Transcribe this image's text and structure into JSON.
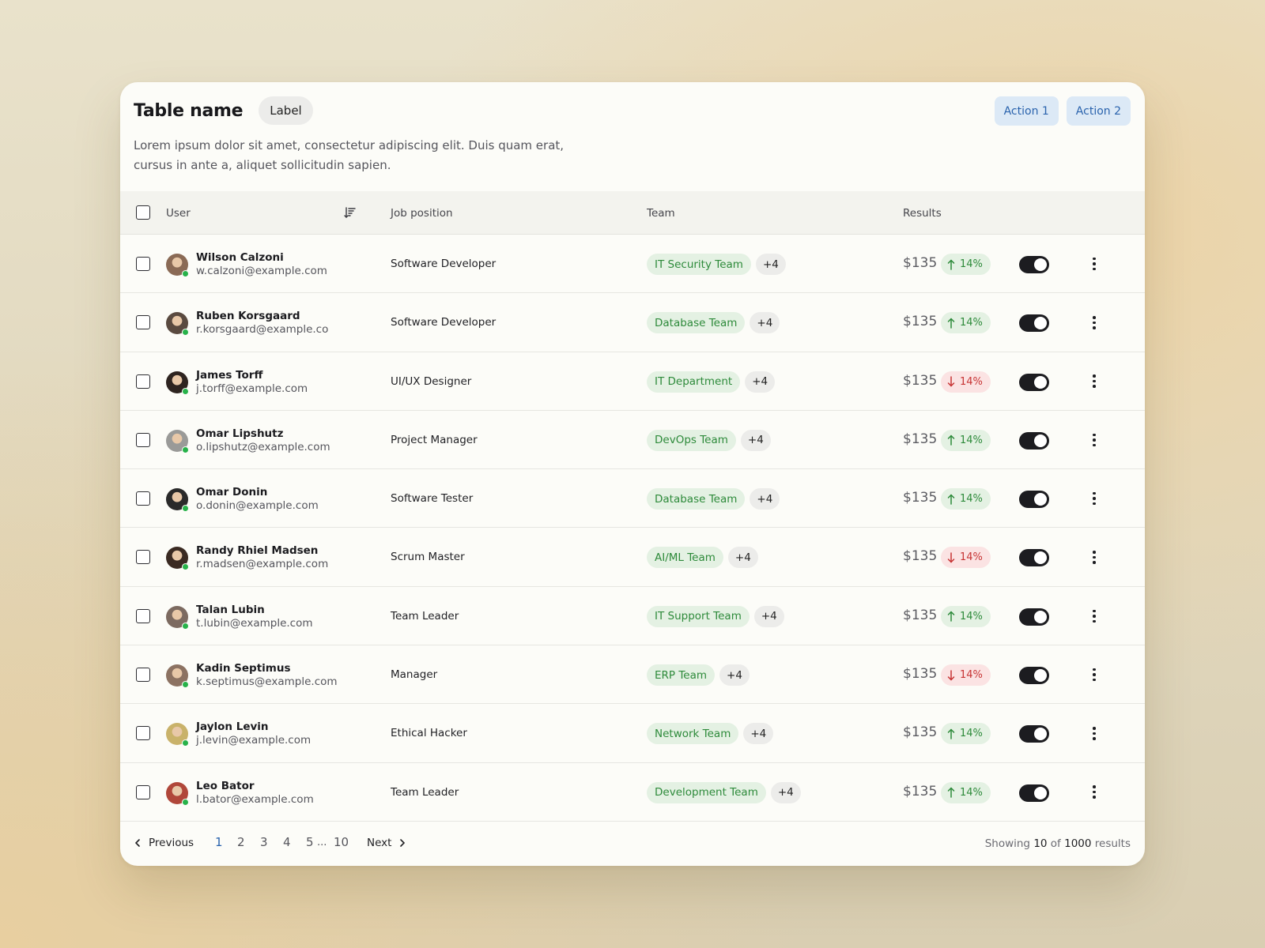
{
  "header": {
    "title": "Table name",
    "label": "Label",
    "description": "Lorem ipsum dolor sit amet, consectetur adipiscing elit. Duis quam erat, cursus in ante a, aliquet sollicitudin sapien.",
    "actions": [
      "Action 1",
      "Action 2"
    ]
  },
  "columns": {
    "user": "User",
    "job": "Job position",
    "team": "Team",
    "results": "Results"
  },
  "rows": [
    {
      "name": "Wilson Calzoni",
      "email": "w.calzoni@example.com",
      "job": "Software Developer",
      "team": "IT Security Team",
      "extra": "+4",
      "amount": "$135",
      "trend": "up",
      "percent": "14%",
      "toggle_on": true,
      "avatar_color": "#8a6a55"
    },
    {
      "name": "Ruben Korsgaard",
      "email": "r.korsgaard@example.co",
      "job": "Software Developer",
      "team": "Database Team",
      "extra": "+4",
      "amount": "$135",
      "trend": "up",
      "percent": "14%",
      "toggle_on": true,
      "avatar_color": "#5a4a40"
    },
    {
      "name": "James Torff",
      "email": "j.torff@example.com",
      "job": "UI/UX Designer",
      "team": "IT Department",
      "extra": "+4",
      "amount": "$135",
      "trend": "down",
      "percent": "14%",
      "toggle_on": true,
      "avatar_color": "#2e2420"
    },
    {
      "name": "Omar Lipshutz",
      "email": "o.lipshutz@example.com",
      "job": "Project Manager",
      "team": "DevOps Team",
      "extra": "+4",
      "amount": "$135",
      "trend": "up",
      "percent": "14%",
      "toggle_on": true,
      "avatar_color": "#9a9a98"
    },
    {
      "name": "Omar Donin",
      "email": "o.donin@example.com",
      "job": "Software Tester",
      "team": "Database Team",
      "extra": "+4",
      "amount": "$135",
      "trend": "up",
      "percent": "14%",
      "toggle_on": true,
      "avatar_color": "#2a2a2a"
    },
    {
      "name": "Randy Rhiel Madsen",
      "email": "r.madsen@example.com",
      "job": "Scrum Master",
      "team": "AI/ML Team",
      "extra": "+4",
      "amount": "$135",
      "trend": "down",
      "percent": "14%",
      "toggle_on": true,
      "avatar_color": "#3a2a22"
    },
    {
      "name": "Talan Lubin",
      "email": "t.lubin@example.com",
      "job": "Team Leader",
      "team": "IT Support Team",
      "extra": "+4",
      "amount": "$135",
      "trend": "up",
      "percent": "14%",
      "toggle_on": true,
      "avatar_color": "#7c6a60"
    },
    {
      "name": "Kadin Septimus",
      "email": "k.septimus@example.com",
      "job": "Manager",
      "team": "ERP Team",
      "extra": "+4",
      "amount": "$135",
      "trend": "down",
      "percent": "14%",
      "toggle_on": true,
      "avatar_color": "#8c7262"
    },
    {
      "name": "Jaylon Levin",
      "email": "j.levin@example.com",
      "job": "Ethical Hacker",
      "team": "Network Team",
      "extra": "+4",
      "amount": "$135",
      "trend": "up",
      "percent": "14%",
      "toggle_on": true,
      "avatar_color": "#c9b26a"
    },
    {
      "name": "Leo Bator",
      "email": "l.bator@example.com",
      "job": "Team Leader",
      "team": "Development Team",
      "extra": "+4",
      "amount": "$135",
      "trend": "up",
      "percent": "14%",
      "toggle_on": true,
      "avatar_color": "#b0473a"
    }
  ],
  "pagination": {
    "previous": "Previous",
    "next": "Next",
    "pages": [
      "1",
      "2",
      "3",
      "4",
      "5"
    ],
    "ellipsis": "...",
    "last": "10",
    "current": "1",
    "showing_prefix": "Showing",
    "showing_count": "10",
    "showing_of": "of",
    "showing_total": "1000",
    "showing_suffix": "results"
  },
  "colors": {
    "accent_blue": "#2a63ad",
    "positive": "#2d8a3a",
    "negative": "#c73434",
    "toggle": "#1c1c20",
    "online": "#27b24a"
  }
}
